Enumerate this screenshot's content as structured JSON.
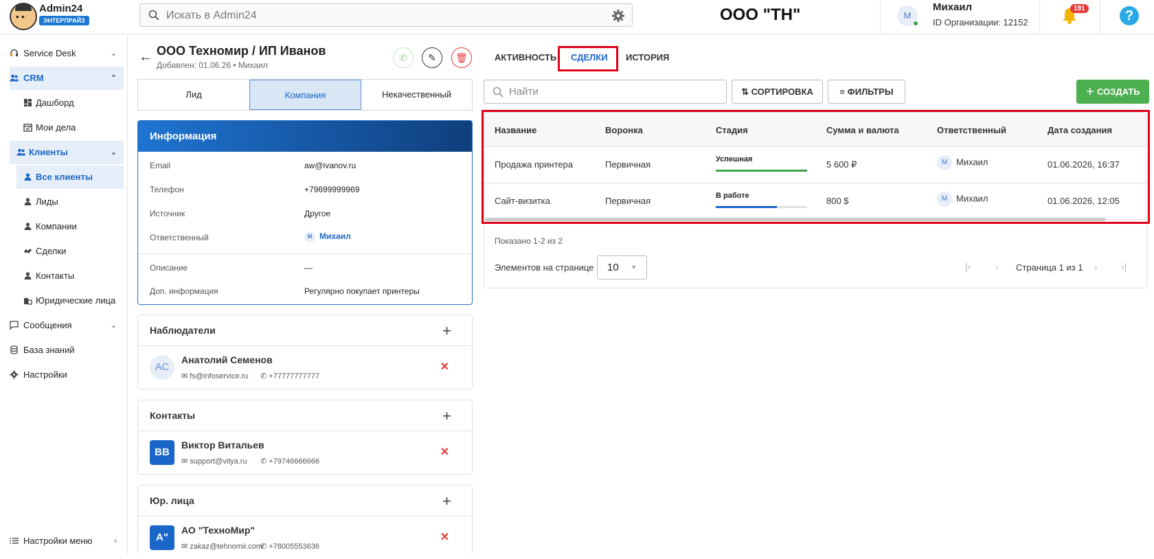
{
  "app": {
    "name": "Admin24",
    "plan": "ЭНТЕРПРАЙЗ"
  },
  "header": {
    "search_placeholder": "Искать в Admin24",
    "org_title": "ООО \"ТН\"",
    "user_initial": "М",
    "user_name": "Михаил",
    "org_id": "ID Организации: 12152",
    "notifications": "191",
    "help": "?"
  },
  "sidebar": {
    "items": [
      {
        "label": "Service Desk",
        "icon": "headset-icon"
      },
      {
        "label": "CRM",
        "icon": "people-icon"
      },
      {
        "label": "Дашборд",
        "icon": "dashboard-icon"
      },
      {
        "label": "Мои дела",
        "icon": "calendar-icon"
      },
      {
        "label": "Клиенты",
        "icon": "people-icon"
      },
      {
        "label": "Все клиенты",
        "icon": "person-icon"
      },
      {
        "label": "Лиды",
        "icon": "person-icon"
      },
      {
        "label": "Компании",
        "icon": "person-icon"
      },
      {
        "label": "Сделки",
        "icon": "handshake-icon"
      },
      {
        "label": "Контакты",
        "icon": "person-icon"
      },
      {
        "label": "Юридические лица",
        "icon": "building-icon"
      },
      {
        "label": "Сообщения",
        "icon": "message-icon"
      },
      {
        "label": "База знаний",
        "icon": "database-icon"
      },
      {
        "label": "Настройки",
        "icon": "gear-icon"
      }
    ],
    "footer": "Настройки меню"
  },
  "client": {
    "title": "ООО Техномир / ИП Иванов",
    "subtitle": "Добавлен: 01.06.26 • Михаил",
    "type_tabs": [
      "Лид",
      "Компания",
      "Некачественный"
    ],
    "info_title": "Информация",
    "info": [
      {
        "label": "Email",
        "value": "aw@ivanov.ru"
      },
      {
        "label": "Телефон",
        "value": "+79699999969"
      },
      {
        "label": "Источник",
        "value": "Другое"
      },
      {
        "label": "Ответственный",
        "value": "Михаил",
        "initial": "М"
      },
      {
        "label": "Описание",
        "value": "—"
      },
      {
        "label": "Доп. информация",
        "value": "Регулярно покупает принтеры"
      }
    ],
    "observers": {
      "title": "Наблюдатели",
      "items": [
        {
          "initials": "АС",
          "name": "Анатолий Семенов",
          "email": "fs@infoservice.ru",
          "phone": "+77777777777"
        }
      ]
    },
    "contacts": {
      "title": "Контакты",
      "items": [
        {
          "initials": "ВВ",
          "name": "Виктор Витальев",
          "email": "support@vitya.ru",
          "phone": "+79746666666"
        }
      ]
    },
    "legal": {
      "title": "Юр. лица",
      "items": [
        {
          "initials": "А\"",
          "name": "АО \"ТехноМир\"",
          "email": "zakaz@tehnomir.com",
          "phone": "+78005553636"
        }
      ]
    }
  },
  "deals": {
    "tabs": [
      "АКТИВНОСТЬ",
      "СДЕЛКИ",
      "ИСТОРИЯ"
    ],
    "search_placeholder": "Найти",
    "sort_label": "СОРТИРОВКА",
    "filter_label": "ФИЛЬТРЫ",
    "create_label": "СОЗДАТЬ",
    "columns": [
      "Название",
      "Воронка",
      "Стадия",
      "Сумма и валюта",
      "Ответственный",
      "Дата создания"
    ],
    "rows": [
      {
        "name": "Продажа принтера",
        "funnel": "Первичная",
        "stage": "Успешная",
        "stage_progress": 1.0,
        "stage_color": "#3aa14a",
        "amount": "5 600 ₽",
        "owner_initial": "М",
        "owner": "Михаил",
        "created": "01.06.2026, 16:37"
      },
      {
        "name": "Сайт-визитка",
        "funnel": "Первичная",
        "stage": "В работе",
        "stage_progress": 0.67,
        "stage_color": "#1a66c9",
        "amount": "800 $",
        "owner_initial": "М",
        "owner": "Михаил",
        "created": "01.06.2026, 12:05"
      }
    ],
    "shown_text": "Показано 1-2 из 2",
    "per_page_label": "Элементов на странице",
    "per_page_value": "10",
    "page_text": "Страница 1 из 1"
  }
}
